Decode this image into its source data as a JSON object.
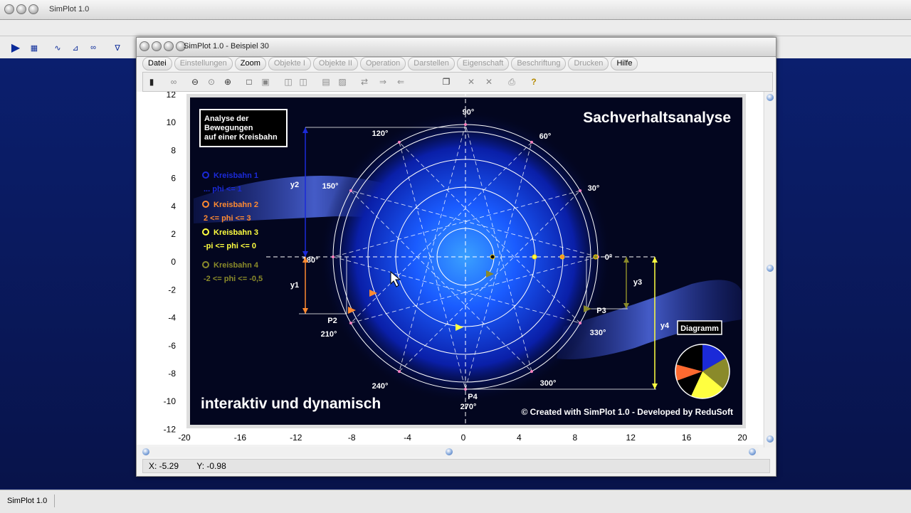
{
  "app": {
    "title": "SimPlot 1.0",
    "status": "SimPlot 1.0"
  },
  "window": {
    "title": "SimPlot 1.0 - Beispiel 30",
    "menu": [
      {
        "label": "Datei",
        "enabled": true
      },
      {
        "label": "Einstellungen",
        "enabled": false
      },
      {
        "label": "Zoom",
        "enabled": true
      },
      {
        "label": "Objekte I",
        "enabled": false
      },
      {
        "label": "Objekte II",
        "enabled": false
      },
      {
        "label": "Operation",
        "enabled": false
      },
      {
        "label": "Darstellen",
        "enabled": false
      },
      {
        "label": "Eigenschaft",
        "enabled": false
      },
      {
        "label": "Beschriftung",
        "enabled": false
      },
      {
        "label": "Drucken",
        "enabled": false
      },
      {
        "label": "Hilfe",
        "enabled": true
      }
    ],
    "coords": {
      "x": "X: -5.29",
      "y": "Y: -0.98"
    }
  },
  "axes": {
    "y_ticks": [
      "12",
      "10",
      "8",
      "6",
      "4",
      "2",
      "0",
      "-2",
      "-4",
      "-6",
      "-8",
      "-10",
      "-12"
    ],
    "x_ticks": [
      "-20",
      "-16",
      "-12",
      "-8",
      "-4",
      "0",
      "4",
      "8",
      "12",
      "16",
      "20"
    ]
  },
  "image": {
    "heading": "Sachverhaltsanalyse",
    "box": [
      "Analyse der",
      "Bewegungen",
      "auf einer Kreisbahn"
    ],
    "tagline": "interaktiv und dynamisch",
    "copyright": "© Created with SimPlot 1.0 - Developed by ReduSoft",
    "legend": [
      {
        "name": "Kreisbahn 1",
        "range": "... phi <= 1",
        "color": "#1b2ad8"
      },
      {
        "name": "Kreisbahn 2",
        "range": "2 <= phi <= 3",
        "color": "#ff8a30"
      },
      {
        "name": "Kreisbahn 3",
        "range": "-pi <= phi <= 0",
        "color": "#ffff40"
      },
      {
        "name": "Kreisbahn 4",
        "range": "-2 <= phi <= -0,5",
        "color": "#8a8a2a"
      }
    ],
    "angles": [
      "0°",
      "30°",
      "60°",
      "90°",
      "120°",
      "150°",
      "180°",
      "210°",
      "240°",
      "270°",
      "300°",
      "330°"
    ],
    "points": [
      "P2",
      "P3",
      "P4"
    ],
    "dims": [
      "y1",
      "y2",
      "y3",
      "y4"
    ],
    "diagram_label": "Diagramm"
  },
  "colors": {
    "bg": "#04082e",
    "accent": "#1a5cff"
  }
}
